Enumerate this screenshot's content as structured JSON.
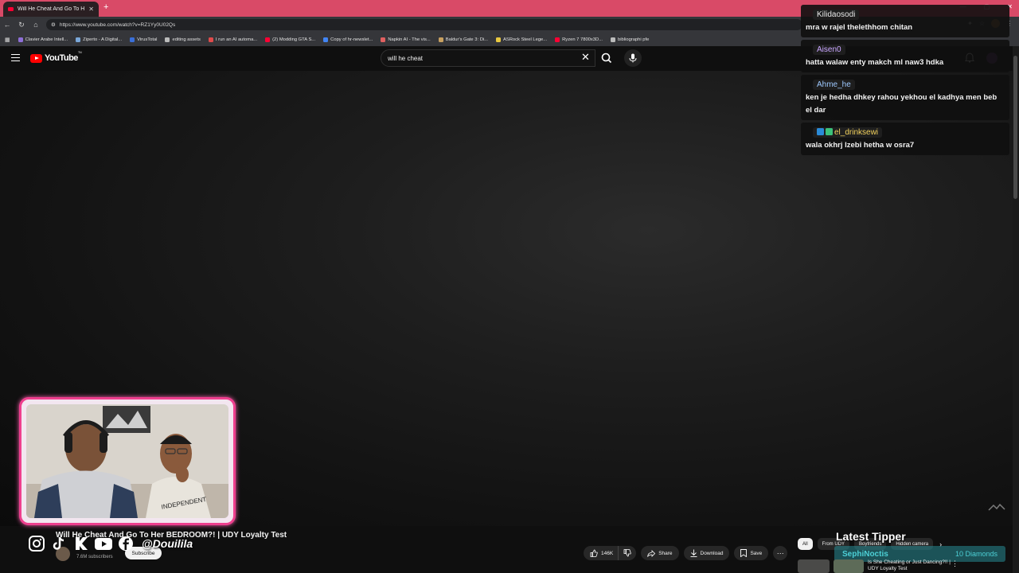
{
  "browser": {
    "tab_title": "Will He Cheat And Go To Her BEDR",
    "url": "https://www.youtube.com/watch?v=RZ1Yy0U02Qs",
    "bookmarks": [
      "Clavier Arabe Intell...",
      "Ziperto - A Digital...",
      "VirusTotal",
      "editing assets",
      "I run an AI automa...",
      "(2) Modding GTA S...",
      "Copy of hr-newslet...",
      "Napkin AI - The vis...",
      "Baldur's Gate 3: Di...",
      "ASRock Steel Lege...",
      "Ryzen 7 7800x3D...",
      "bibliographi pfe"
    ]
  },
  "youtube": {
    "logo_text": "YouTube",
    "logo_suffix": "TN",
    "search_value": "will he cheat"
  },
  "video": {
    "title": "Will He Cheat And Go To Her BEDROOM?! | UDY Loyalty Test",
    "subscribers": "7.6M subscribers",
    "subscribe_label": "Subscribe",
    "likes": "146K",
    "share_label": "Share",
    "download_label": "Download",
    "save_label": "Save"
  },
  "overlay": {
    "handle": "@Douilila",
    "latest_tipper_label": "Latest Tipper",
    "tipper_name": "SephiNoctis",
    "tipper_amount": "10 Diamonds"
  },
  "chips": [
    "All",
    "From UDY",
    "Boyfriends",
    "Hidden camera"
  ],
  "suggestion": {
    "title": "Is She Cheating or Just Dancing?!! | UDY Loyalty Test"
  },
  "chat": [
    {
      "user": "Kilidaosodi",
      "color": "#e8e8e8",
      "text": "mra w rajel thelethhom chitan"
    },
    {
      "user": "Aisen0",
      "color": "#c9a6ff",
      "text": "hatta walaw enty makch ml naw3 hdka"
    },
    {
      "user": "Ahme_he",
      "color": "#9ec9ff",
      "text": "ken je hedha dhkey rahou yekhou el kadhya men beb el dar"
    },
    {
      "user": "el_drinksewi",
      "color": "#f4d35e",
      "text": "wala okhrj lzebi hetha w osra7"
    }
  ]
}
